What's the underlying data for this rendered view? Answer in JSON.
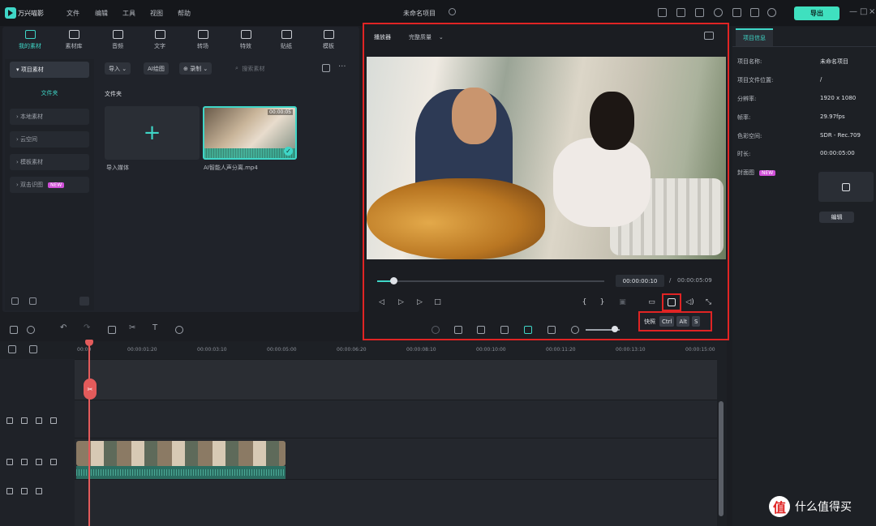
{
  "title_bar": {
    "app_name": "万兴喵影",
    "menus": [
      "文件",
      "编辑",
      "工具",
      "视图",
      "帮助"
    ],
    "doc_title": "未命名项目",
    "export_label": "导出",
    "win_controls": [
      "—",
      "□",
      "×"
    ]
  },
  "tool_tabs": [
    {
      "label": "我的素材",
      "icon": "media-icon",
      "active": true
    },
    {
      "label": "素材库",
      "icon": "library-icon"
    },
    {
      "label": "音频",
      "icon": "music-icon"
    },
    {
      "label": "文字",
      "icon": "text-icon"
    },
    {
      "label": "转场",
      "icon": "transition-icon"
    },
    {
      "label": "特效",
      "icon": "effects-icon"
    },
    {
      "label": "贴纸",
      "icon": "sticker-icon"
    },
    {
      "label": "模板",
      "icon": "template-icon"
    }
  ],
  "side_nav": {
    "project_media": "项目素材",
    "folder": "文件夹",
    "items": [
      "本地素材",
      "云空间",
      "模板素材",
      "双击识图"
    ],
    "new_badge": "NEW"
  },
  "media_toolbar": {
    "import": "导入",
    "ai": "AI绘图",
    "record": "录制",
    "search_placeholder": "搜索素材"
  },
  "media": {
    "folder_label": "文件夹",
    "import_tile_label": "导入媒体",
    "clip_name": "AI智能人声分离.mp4",
    "clip_duration": "00:00:05"
  },
  "player": {
    "label": "播放器",
    "quality": "完整质量",
    "time_current": "00:00:00:10",
    "time_sep": "/",
    "time_total": "00:00:05:09"
  },
  "shortcut": {
    "label": "快照",
    "keys": [
      "Ctrl",
      "Alt",
      "S"
    ]
  },
  "timeline": {
    "ticks": [
      "00:00",
      "00:00:01:20",
      "00:00:03:10",
      "00:00:05:00",
      "00:00:06:20",
      "00:00:08:10",
      "00:00:10:00",
      "00:00:11:20",
      "00:00:13:10",
      "00:00:15:00"
    ],
    "progress_fraction": 0.07,
    "zoom_fraction": 0.85
  },
  "right_panel": {
    "tab": "项目信息",
    "fields": [
      {
        "label": "项目名称:",
        "value": "未命名项目"
      },
      {
        "label": "项目文件位置:",
        "value": "/"
      },
      {
        "label": "分辨率:",
        "value": "1920 x 1080"
      },
      {
        "label": "帧率:",
        "value": "29.97fps"
      },
      {
        "label": "色彩空间:",
        "value": "SDR - Rec.709"
      },
      {
        "label": "时长:",
        "value": "00:00:05:00"
      }
    ],
    "cover_label": "封面图",
    "cover_badge": "NEW",
    "cover_edit": "编辑"
  },
  "watermark": {
    "logo": "值",
    "text": "什么值得买"
  },
  "colors": {
    "accent": "#3fd6c7",
    "highlight": "#e02424",
    "playhead": "#e35b5b"
  }
}
